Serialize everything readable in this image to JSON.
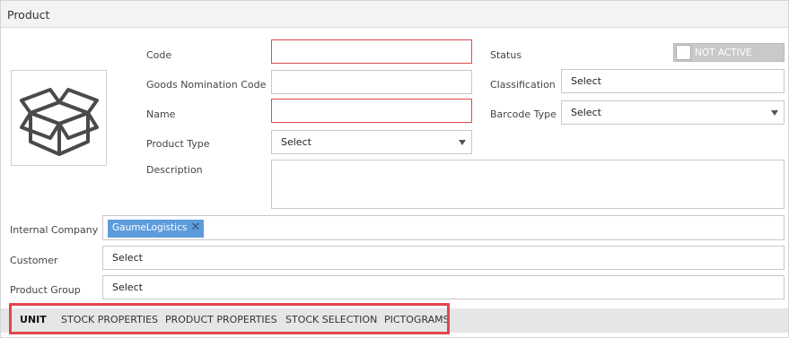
{
  "window": {
    "title": "Product"
  },
  "image": {
    "icon": "package-box-icon"
  },
  "form": {
    "code": {
      "label": "Code",
      "value": ""
    },
    "goods_nomination_code": {
      "label": "Goods Nomination Code",
      "value": ""
    },
    "name": {
      "label": "Name",
      "value": ""
    },
    "product_type": {
      "label": "Product Type",
      "value": "Select"
    },
    "description": {
      "label": "Description",
      "value": ""
    },
    "status": {
      "label": "Status",
      "toggle_text": "NOT ACTIVE"
    },
    "classification": {
      "label": "Classification",
      "value": "Select"
    },
    "barcode_type": {
      "label": "Barcode Type",
      "value": "Select"
    },
    "internal_company": {
      "label": "Internal Company",
      "tag": "GaumeLogistics"
    },
    "customer": {
      "label": "Customer",
      "value": "Select"
    },
    "product_group": {
      "label": "Product Group",
      "value": "Select"
    }
  },
  "tabs": [
    {
      "label": "UNIT",
      "active": true
    },
    {
      "label": "STOCK PROPERTIES",
      "active": false
    },
    {
      "label": "PRODUCT PROPERTIES",
      "active": false
    },
    {
      "label": "STOCK SELECTION",
      "active": false
    },
    {
      "label": "PICTOGRAMS",
      "active": false
    }
  ],
  "colors": {
    "error_border": "#e04b4b",
    "tag_bg": "#5d9cdc",
    "highlight": "#e0474c",
    "toggle_off": "#c9c9c9"
  }
}
